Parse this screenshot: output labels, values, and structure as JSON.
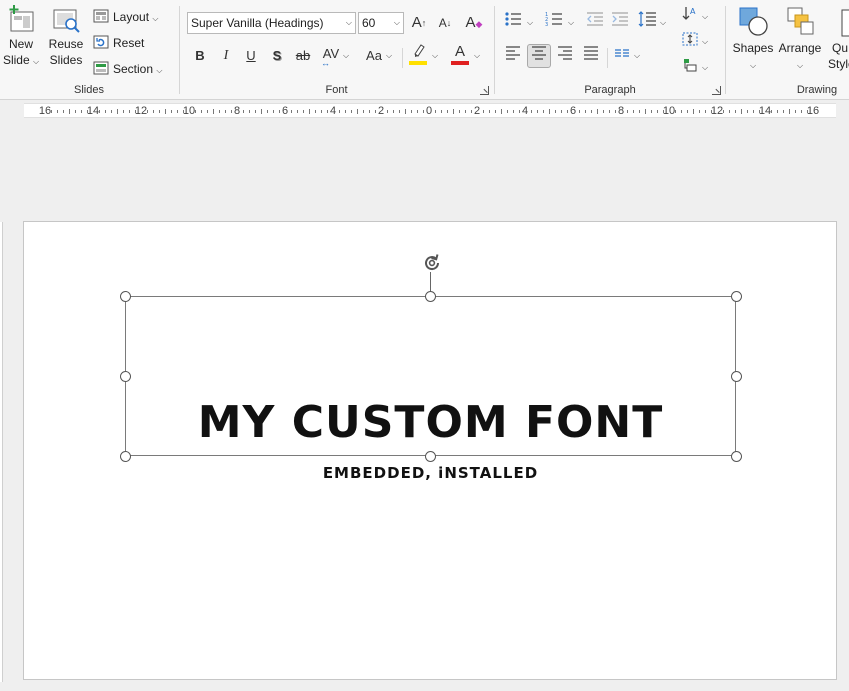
{
  "ribbon": {
    "slides": {
      "group_label": "Slides",
      "new_slide_line1": "New",
      "new_slide_line2": "Slide",
      "reuse_line1": "Reuse",
      "reuse_line2": "Slides",
      "layout": "Layout",
      "reset": "Reset",
      "section": "Section"
    },
    "font": {
      "group_label": "Font",
      "font_name": "Super Vanilla (Headings)",
      "font_size": "60",
      "grow": "A",
      "shrink": "A",
      "clear_format": "A",
      "bold": "B",
      "italic": "I",
      "underline": "U",
      "shadow": "S",
      "strikethrough": "ab",
      "spacing": "AV",
      "change_case": "Aa",
      "font_color": "A",
      "highlight_color": "#ffe000",
      "font_color_value": "#e02020"
    },
    "paragraph": {
      "group_label": "Paragraph"
    },
    "drawing": {
      "group_label": "Drawing",
      "shapes": "Shapes",
      "arrange": "Arrange",
      "quick_line1": "Qu",
      "quick_line2": "Style"
    }
  },
  "ruler": {
    "labels": [
      "16",
      "14",
      "12",
      "10",
      "8",
      "6",
      "4",
      "2",
      "0",
      "2",
      "4",
      "6",
      "8",
      "10",
      "12",
      "14",
      "16"
    ]
  },
  "slide": {
    "title": "MY CUSTOM FONT",
    "subtitle": "EMBEDDED, iNSTALLED"
  }
}
